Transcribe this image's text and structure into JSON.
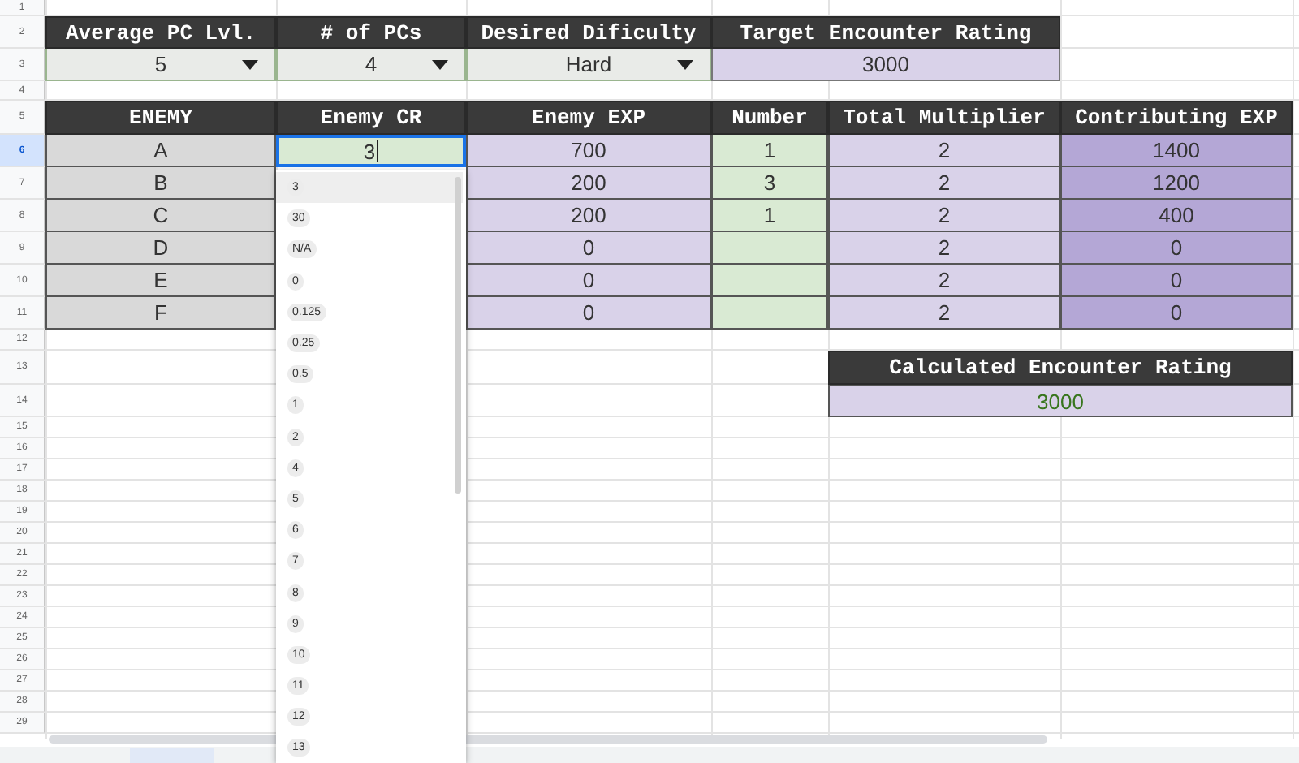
{
  "row_numbers": [
    "1",
    "2",
    "3",
    "4",
    "5",
    "6",
    "7",
    "8",
    "9",
    "10",
    "11",
    "12",
    "13",
    "14",
    "15",
    "16",
    "17",
    "18",
    "19",
    "20",
    "21",
    "22",
    "23",
    "24",
    "25",
    "26",
    "27",
    "28",
    "29"
  ],
  "settings": {
    "headers": [
      "Average PC Lvl.",
      "# of PCs",
      "Desired Dificulty",
      "Target Encounter Rating"
    ],
    "values": [
      {
        "text": "5",
        "kind": "dropdown"
      },
      {
        "text": "4",
        "kind": "dropdown"
      },
      {
        "text": "Hard",
        "kind": "dropdown"
      },
      {
        "text": "3000",
        "kind": "computed"
      }
    ]
  },
  "enemy_table": {
    "columns": [
      {
        "label": "ENEMY",
        "kind": "name"
      },
      {
        "label": "Enemy CR",
        "kind": "input"
      },
      {
        "label": "Enemy EXP",
        "kind": "computed"
      },
      {
        "label": "Number",
        "kind": "input"
      },
      {
        "label": "Total Multiplier",
        "kind": "computed"
      },
      {
        "label": "Contributing EXP",
        "kind": "total"
      }
    ],
    "rows": [
      {
        "cells": [
          "A",
          "3",
          "700",
          "1",
          "2",
          "1400"
        ],
        "active": true
      },
      {
        "cells": [
          "B",
          null,
          "200",
          "3",
          "2",
          "1200"
        ],
        "active": false
      },
      {
        "cells": [
          "C",
          null,
          "200",
          "1",
          "2",
          "400"
        ],
        "active": false
      },
      {
        "cells": [
          "D",
          null,
          "0",
          null,
          "2",
          "0"
        ],
        "active": false
      },
      {
        "cells": [
          "E",
          null,
          "0",
          null,
          "2",
          "0"
        ],
        "active": false
      },
      {
        "cells": [
          "F",
          null,
          "0",
          null,
          "2",
          "0"
        ],
        "active": false
      }
    ]
  },
  "calculated": {
    "header": "Calculated Encounter Rating",
    "value": "3000"
  },
  "cr_dropdown": {
    "options": [
      {
        "label": "3",
        "selected": true
      },
      {
        "label": "30",
        "selected": false
      },
      {
        "label": "N/A",
        "selected": false
      },
      {
        "label": "0",
        "selected": false
      },
      {
        "label": "0.125",
        "selected": false
      },
      {
        "label": "0.25",
        "selected": false
      },
      {
        "label": "0.5",
        "selected": false
      },
      {
        "label": "1",
        "selected": false
      },
      {
        "label": "2",
        "selected": false
      },
      {
        "label": "4",
        "selected": false
      },
      {
        "label": "5",
        "selected": false
      },
      {
        "label": "6",
        "selected": false
      },
      {
        "label": "7",
        "selected": false
      },
      {
        "label": "8",
        "selected": false
      },
      {
        "label": "9",
        "selected": false
      },
      {
        "label": "10",
        "selected": false
      },
      {
        "label": "11",
        "selected": false
      },
      {
        "label": "12",
        "selected": false
      },
      {
        "label": "13",
        "selected": false
      }
    ]
  }
}
